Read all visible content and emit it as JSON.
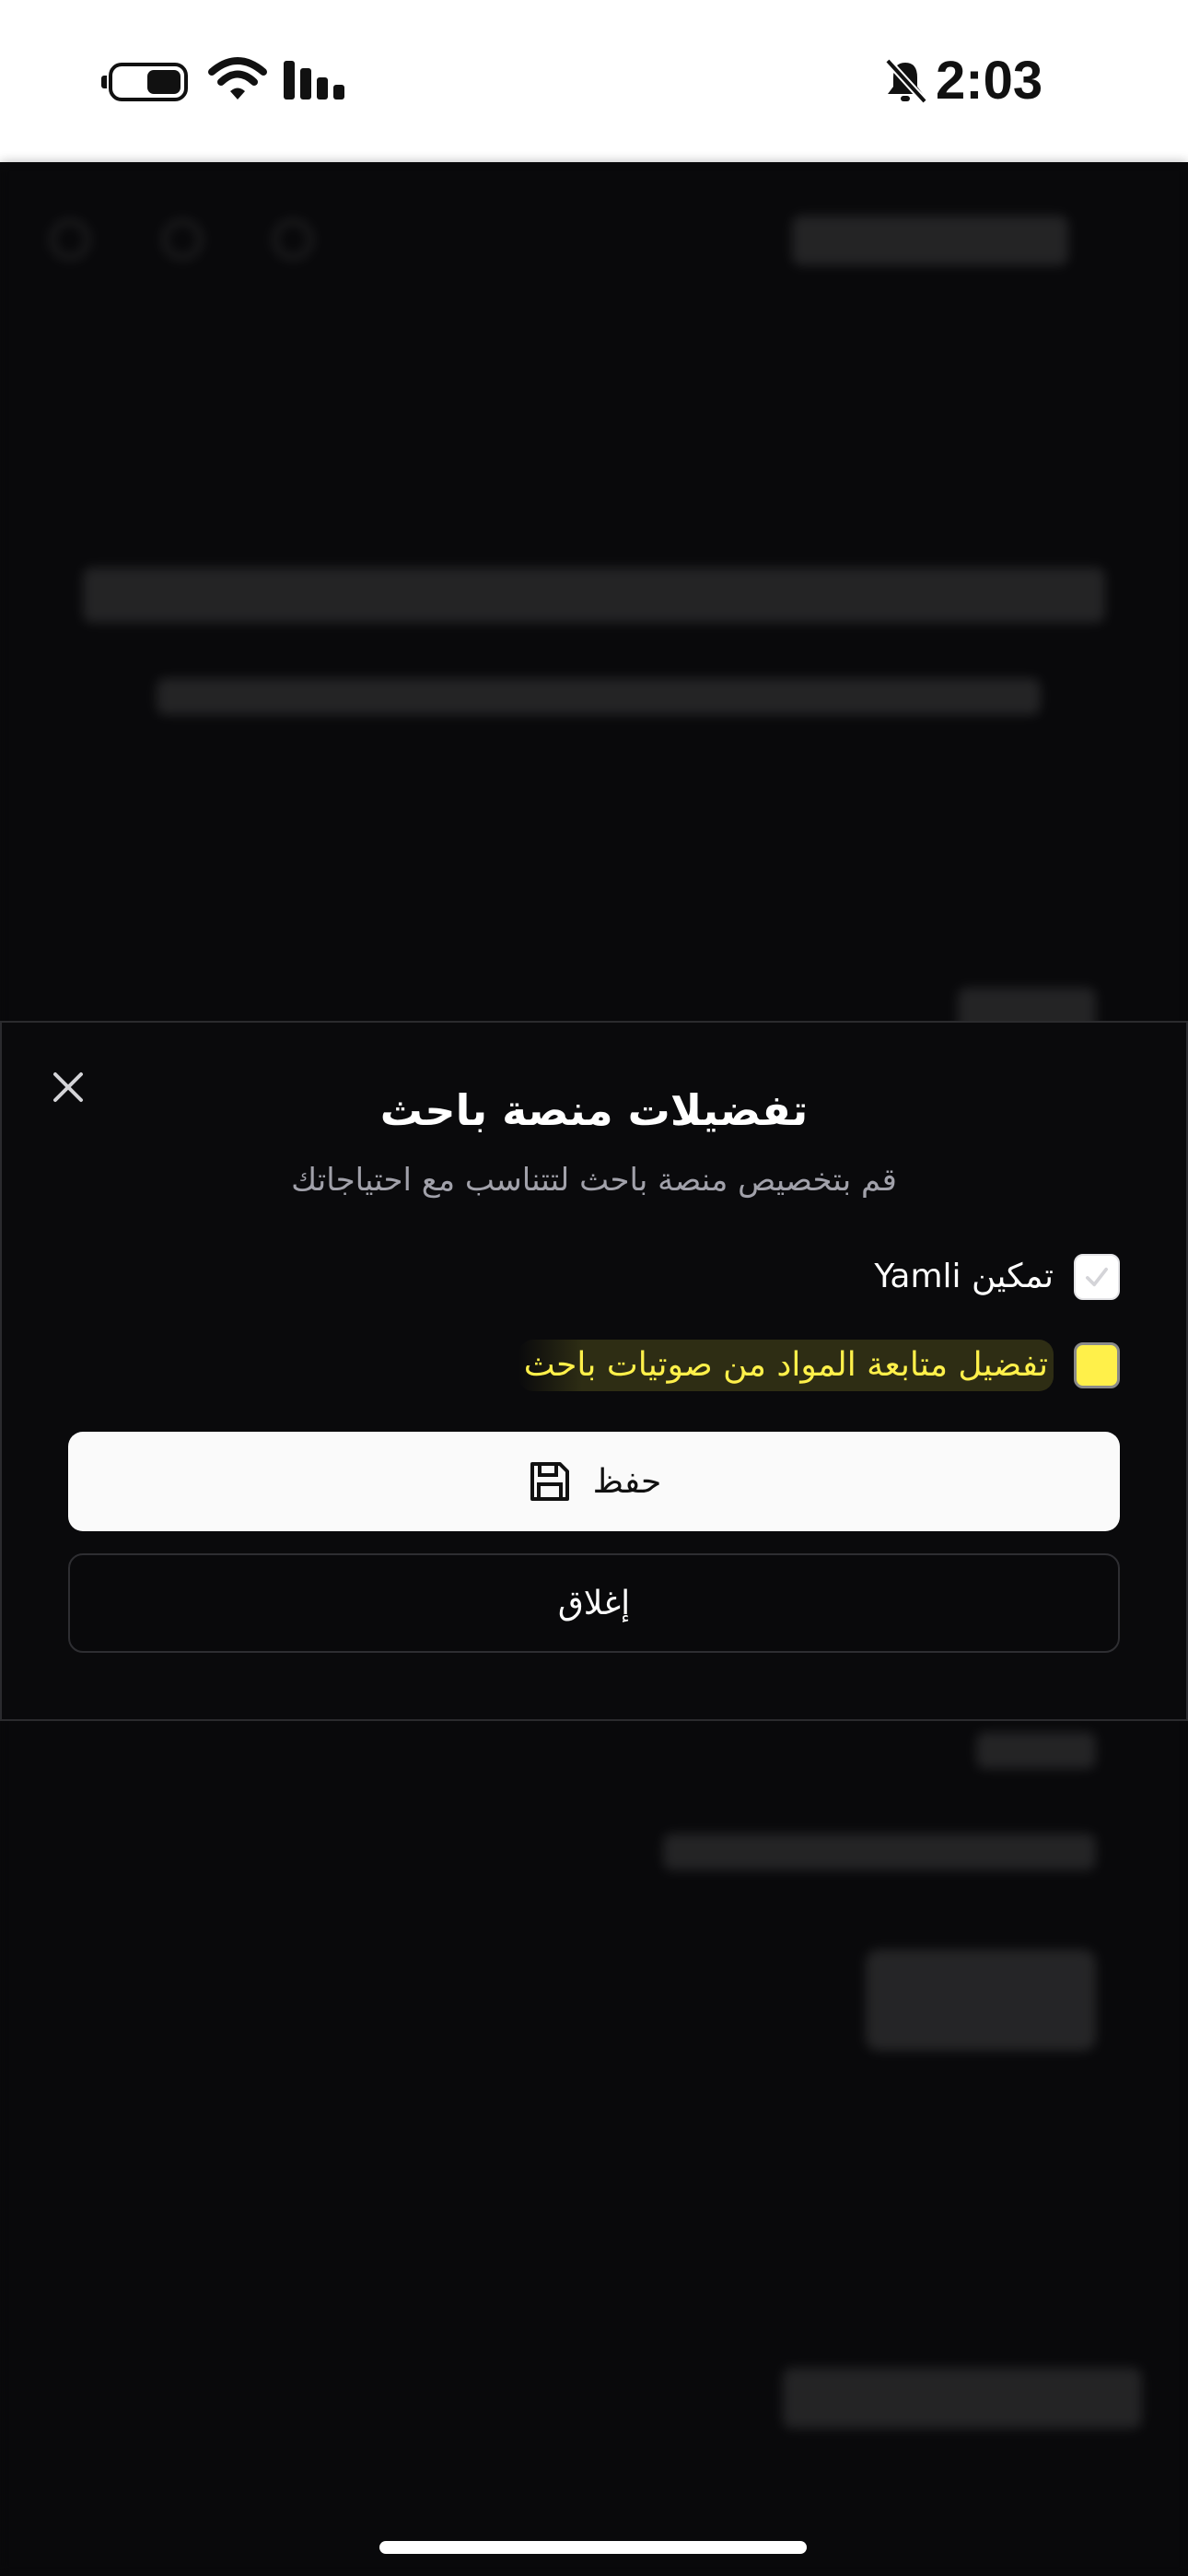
{
  "status_bar": {
    "time": "2:03",
    "icons": [
      "battery-icon",
      "wifi-icon",
      "signal-icon",
      "bell-muted-icon"
    ]
  },
  "modal": {
    "title": "تفضيلات منصة باحث",
    "description": "قم بتخصيص منصة باحث لتتناسب مع احتياجاتك",
    "options": [
      {
        "label": "تمكين Yamli",
        "checked": true
      },
      {
        "label": "تفضيل متابعة المواد من صوتيات باحث",
        "checked": false,
        "highlighted": true
      }
    ],
    "save_label": "حفظ",
    "close_label": "إغلاق"
  },
  "colors": {
    "background": "#09090b",
    "modal_background": "#0a0a0c",
    "highlight": "#fff04a",
    "muted_text": "#a1a1aa"
  }
}
